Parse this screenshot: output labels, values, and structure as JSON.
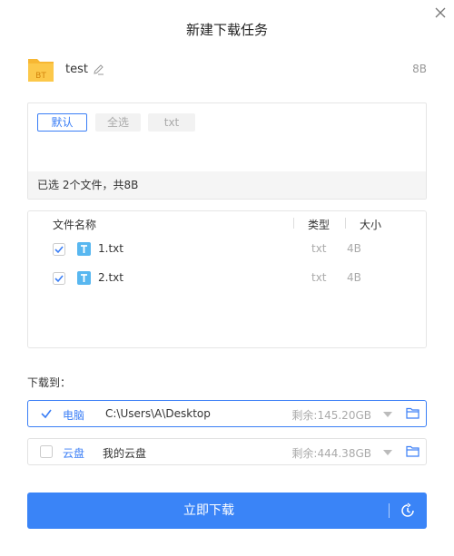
{
  "dialog": {
    "title": "新建下载任务"
  },
  "colors": {
    "accent": "#3a7ef6",
    "button": "#3a84f7",
    "folder": "#f7b733",
    "txt_icon": "#58b7f0"
  },
  "torrent": {
    "name": "test",
    "size": "8B",
    "icon_badge": "BT"
  },
  "filters": {
    "items": [
      "默认",
      "全选",
      "txt"
    ],
    "active": "默认"
  },
  "selection_summary": "已选 2个文件，共8B",
  "file_list": {
    "headers": {
      "name": "文件名称",
      "type": "类型",
      "size": "大小"
    },
    "rows": [
      {
        "name": "1.txt",
        "type": "txt",
        "size": "4B",
        "checked": true,
        "icon": "T"
      },
      {
        "name": "2.txt",
        "type": "txt",
        "size": "4B",
        "checked": true,
        "icon": "T"
      }
    ]
  },
  "download_to": {
    "label": "下载到：",
    "destinations": [
      {
        "type": "电脑",
        "path": "C:\\Users\\A\\Desktop",
        "free": "剩余:145.20GB",
        "checked": true
      },
      {
        "type": "云盘",
        "path": "我的云盘",
        "free": "剩余:444.38GB",
        "checked": false
      }
    ]
  },
  "actions": {
    "download_now": "立即下载"
  }
}
